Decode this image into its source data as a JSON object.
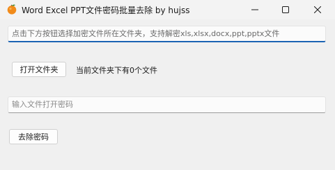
{
  "window": {
    "title": "Word Excel PPT文件密码批量去除    by hujss",
    "icon": "tangerine-icon"
  },
  "path_input": {
    "placeholder": "点击下方按钮选择加密文件所在文件夹，支持解密xls,xlsx,docx,ppt,pptx文件",
    "value": ""
  },
  "open_folder_button": {
    "label": "打开文件夹"
  },
  "status": {
    "text": "当前文件夹下有0个文件"
  },
  "password_input": {
    "placeholder": "输入文件打开密码",
    "value": ""
  },
  "remove_password_button": {
    "label": "去除密码"
  },
  "colors": {
    "accent": "#1b63b3",
    "background": "#f0f0f0",
    "icon_orange": "#f18b1a",
    "icon_leaf": "#3c8a2e"
  }
}
